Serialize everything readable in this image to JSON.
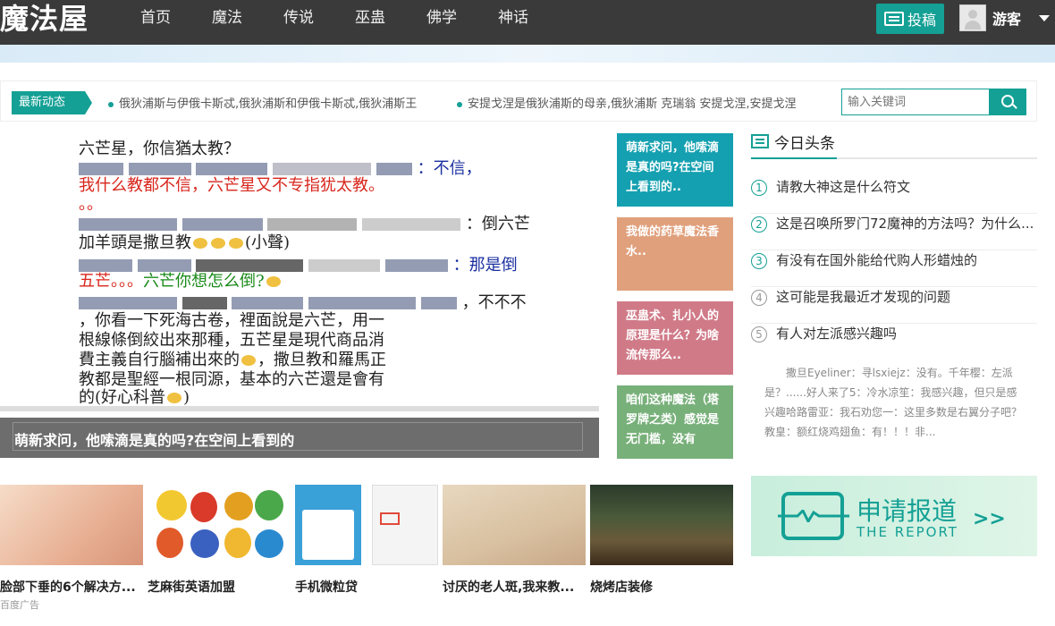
{
  "brand": {
    "logo": "魔法屋"
  },
  "nav": [
    "首页",
    "魔法",
    "传说",
    "巫蛊",
    "佛学",
    "神话"
  ],
  "header": {
    "submit_label": "投稿",
    "username": "游客"
  },
  "ticker": {
    "tag": "最新动态",
    "items": [
      "俄狄浦斯与伊俄卡斯忒,俄狄浦斯和伊俄卡斯忒,俄狄浦斯王",
      "安提戈涅是俄狄浦斯的母亲,俄狄浦斯 克瑞翁 安提戈涅,安提戈涅"
    ]
  },
  "search": {
    "placeholder": "输入关键词"
  },
  "feature": {
    "caption": "萌新求问，他嗦滴是真的吗?在空间上看到的",
    "image_text": {
      "line1": "六芒星，你信猶太教？",
      "line2_tail": "：不信，",
      "line3": "我什么教都不信，六芒星又不专指犹太教。",
      "line4": "。。",
      "line5_tail": "：倒六芒",
      "line6": "加羊頭是撒旦教",
      "line6_tail": "(小聲)",
      "line7_tail": "：那是倒",
      "line8": "五芒。。。",
      "line8_g": "六芒你想怎么倒?",
      "line9_tail": "，不不不",
      "line10": "，你看一下死海古卷，裡面說是六芒，用一",
      "line11": "根線條倒絞出來那種，五芒星是現代商品消",
      "line12": "費主義自行腦補出來的",
      "line12_tail": "，撒旦教和羅馬正",
      "line13": "教都是聖經一根同源，基本的六芒還是會有",
      "line14": "的(好心科普",
      "line14_tail": ")"
    }
  },
  "tiles": [
    {
      "text": "萌新求问，他嗦滴是真的吗?在空间上看到的..",
      "color": "#14a0b0"
    },
    {
      "text": "我做的药草魔法香水..",
      "color": "#e0a07c"
    },
    {
      "text": "巫蛊术、扎小人的原理是什么？为啥流传那么..",
      "color": "#d07a88"
    },
    {
      "text": "咱们这种魔法（塔罗牌之类）感觉是无门槛，没有",
      "color": "#78b07a"
    }
  ],
  "headlines": {
    "title": "今日头条",
    "items": [
      {
        "num": "1",
        "text": "请教大神这是什么符文"
      },
      {
        "num": "2",
        "text": "这是召唤所罗门72魔神的方法吗？为什么..."
      },
      {
        "num": "3",
        "text": "有没有在国外能给代购人形蜡烛的"
      },
      {
        "num": "4",
        "text": "这可能是我最近才发现的问题"
      },
      {
        "num": "5",
        "text": "有人对左派感兴趣吗"
      }
    ],
    "excerpt": "撒旦Eyeliner：寻lsxiejz：没有。千年樱：左派是？......好人来了5：冷水凉笙：我感兴趣，但只是感兴趣哈路雷亚：我石劝您一：这里多数是右翼分子吧？教皇：额红烧鸡翅鱼：有！！！非..."
  },
  "report": {
    "cn": "申请报道",
    "en": "THE REPORT",
    "arrows": ">>"
  },
  "ads": {
    "items": [
      {
        "caption": "脸部下垂的6个解决方..."
      },
      {
        "caption": "芝麻街英语加盟"
      },
      {
        "caption": "手机微粒贷"
      },
      {
        "caption": "讨厌的老人斑,我来教..."
      },
      {
        "caption": "烧烤店装修"
      }
    ],
    "source": "百度广告"
  }
}
